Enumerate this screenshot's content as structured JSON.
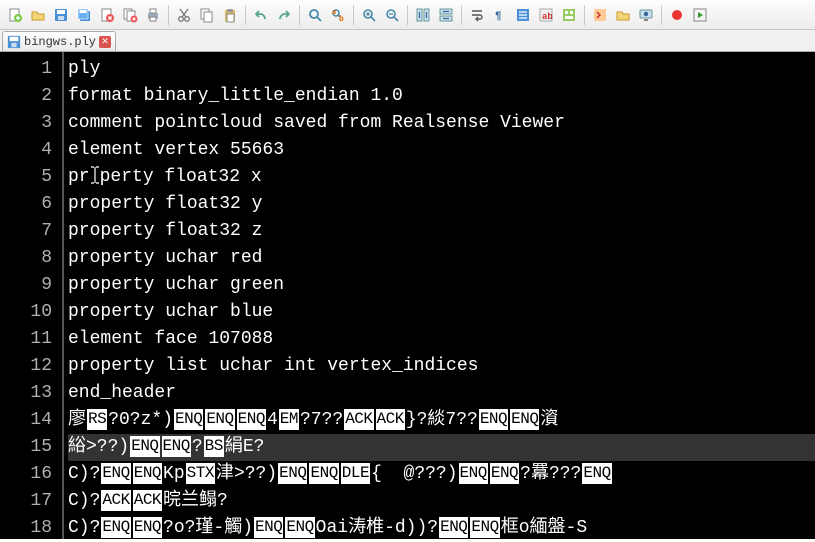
{
  "toolbar": {
    "buttons": [
      {
        "name": "new-file-icon",
        "group": 0
      },
      {
        "name": "open-file-icon",
        "group": 0
      },
      {
        "name": "save-icon",
        "group": 0
      },
      {
        "name": "save-all-icon",
        "group": 0
      },
      {
        "name": "close-icon",
        "group": 0
      },
      {
        "name": "close-all-icon",
        "group": 0
      },
      {
        "name": "print-icon",
        "group": 0
      },
      {
        "name": "cut-icon",
        "group": 1
      },
      {
        "name": "copy-icon",
        "group": 1
      },
      {
        "name": "paste-icon",
        "group": 1
      },
      {
        "name": "undo-icon",
        "group": 2
      },
      {
        "name": "redo-icon",
        "group": 2
      },
      {
        "name": "find-icon",
        "group": 3
      },
      {
        "name": "replace-icon",
        "group": 3
      },
      {
        "name": "zoom-in-icon",
        "group": 4
      },
      {
        "name": "zoom-out-icon",
        "group": 4
      },
      {
        "name": "sync-v-icon",
        "group": 5
      },
      {
        "name": "sync-h-icon",
        "group": 5
      },
      {
        "name": "wrap-icon",
        "group": 6
      },
      {
        "name": "show-all-chars-icon",
        "group": 6
      },
      {
        "name": "indent-guide-icon",
        "group": 6
      },
      {
        "name": "lang-icon",
        "group": 6
      },
      {
        "name": "doc-map-icon",
        "group": 6
      },
      {
        "name": "func-list-icon",
        "group": 7
      },
      {
        "name": "folder-icon",
        "group": 7
      },
      {
        "name": "monitor-icon",
        "group": 7
      },
      {
        "name": "record-icon",
        "group": 8
      },
      {
        "name": "play-macro-icon",
        "group": 8
      }
    ]
  },
  "tab": {
    "filename": "bingws.ply"
  },
  "code": {
    "lines": [
      {
        "n": 1,
        "type": "text",
        "text": "ply"
      },
      {
        "n": 2,
        "type": "text",
        "text": "format binary_little_endian 1.0"
      },
      {
        "n": 3,
        "type": "text",
        "text": "comment pointcloud saved from Realsense Viewer"
      },
      {
        "n": 4,
        "type": "text",
        "text": "element vertex 55663"
      },
      {
        "n": 5,
        "type": "caret",
        "pre": "pr",
        "post": "perty float32 x"
      },
      {
        "n": 6,
        "type": "text",
        "text": "property float32 y"
      },
      {
        "n": 7,
        "type": "text",
        "text": "property float32 z"
      },
      {
        "n": 8,
        "type": "text",
        "text": "property uchar red"
      },
      {
        "n": 9,
        "type": "text",
        "text": "property uchar green"
      },
      {
        "n": 10,
        "type": "text",
        "text": "property uchar blue"
      },
      {
        "n": 11,
        "type": "text",
        "text": "element face 107088"
      },
      {
        "n": 12,
        "type": "text",
        "text": "property list uchar int vertex_indices"
      },
      {
        "n": 13,
        "type": "text",
        "text": "end_header"
      },
      {
        "n": 14,
        "type": "seg",
        "segs": [
          {
            "t": "廖"
          },
          {
            "t": "RS",
            "inv": true
          },
          {
            "t": "?0?z*)"
          },
          {
            "t": "ENQ",
            "inv": true
          },
          {
            "t": "ENQ",
            "inv": true
          },
          {
            "t": "ENQ",
            "inv": true
          },
          {
            "t": "4"
          },
          {
            "t": "EM",
            "inv": true
          },
          {
            "t": "?7??"
          },
          {
            "t": "ACK",
            "inv": true
          },
          {
            "t": "ACK",
            "inv": true
          },
          {
            "t": "}?緂7??"
          },
          {
            "t": "ENQ",
            "inv": true
          },
          {
            "t": "ENQ",
            "inv": true
          },
          {
            "t": "澬"
          }
        ]
      },
      {
        "n": 15,
        "type": "seg",
        "hl": true,
        "segs": [
          {
            "t": "綌>??)"
          },
          {
            "t": "ENQ",
            "inv": true
          },
          {
            "t": "ENQ",
            "inv": true
          },
          {
            "t": "?"
          },
          {
            "t": "BS",
            "inv": true
          },
          {
            "t": "絹E?"
          }
        ]
      },
      {
        "n": 16,
        "type": "seg",
        "segs": [
          {
            "t": "C)?"
          },
          {
            "t": "ENQ",
            "inv": true
          },
          {
            "t": "ENQ",
            "inv": true
          },
          {
            "t": "Kp"
          },
          {
            "t": "STX",
            "inv": true
          },
          {
            "t": "津>??)"
          },
          {
            "t": "ENQ",
            "inv": true
          },
          {
            "t": "ENQ",
            "inv": true
          },
          {
            "t": "DLE",
            "inv": true
          },
          {
            "t": "{  @???)"
          },
          {
            "t": "ENQ",
            "inv": true
          },
          {
            "t": "ENQ",
            "inv": true
          },
          {
            "t": "?羃???"
          },
          {
            "t": "ENQ",
            "inv": true
          }
        ]
      },
      {
        "n": 17,
        "type": "seg",
        "segs": [
          {
            "t": "C)?"
          },
          {
            "t": "ACK",
            "inv": true
          },
          {
            "t": "ACK",
            "inv": true
          },
          {
            "t": "晥兰鳎?"
          }
        ]
      },
      {
        "n": 18,
        "type": "seg",
        "segs": [
          {
            "t": "C)?"
          },
          {
            "t": "ENQ",
            "inv": true
          },
          {
            "t": "ENQ",
            "inv": true
          },
          {
            "t": "?o?瑾-觸)"
          },
          {
            "t": "ENQ",
            "inv": true
          },
          {
            "t": "ENQ",
            "inv": true
          },
          {
            "t": "Oai涛椎-d))?"
          },
          {
            "t": "ENQ",
            "inv": true
          },
          {
            "t": "ENQ",
            "inv": true
          },
          {
            "t": "框o緬盤-S"
          }
        ]
      }
    ]
  }
}
